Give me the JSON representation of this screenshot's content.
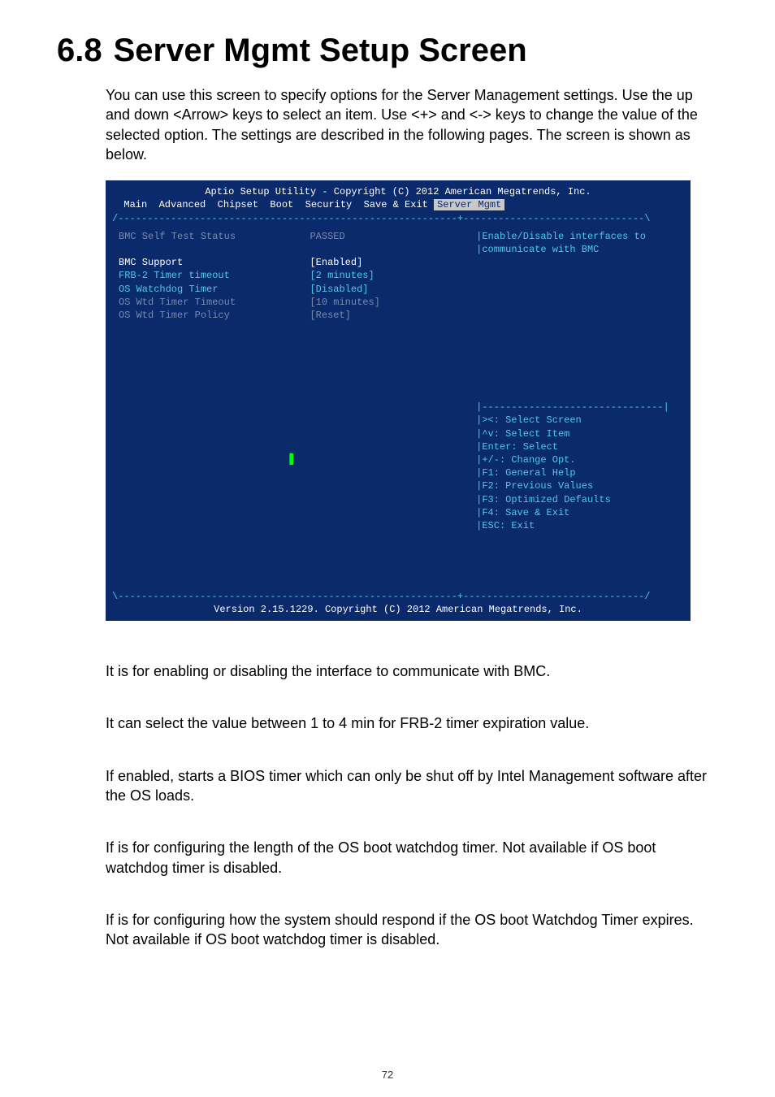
{
  "heading": {
    "num": "6.8",
    "title": "Server Mgmt Setup Screen"
  },
  "intro": "You can use this screen to specify options for the Server Management settings. Use the up and down <Arrow> keys to select an item. Use <+> and <-> keys to change the value of the selected option. The settings are described in the following pages. The screen is shown as below.",
  "bios": {
    "header": "Aptio Setup Utility - Copyright (C) 2012 American Megatrends, Inc.",
    "menu": {
      "left": "  Main  Advanced  Chipset  Boot  Security  Save & Exit ",
      "selected": "Server Mgmt"
    },
    "sep_top": "/----------------------------------------------------------+-------------------------------\\",
    "rows": [
      {
        "lbl": "BMC Self Test Status",
        "val": "PASSED",
        "cls": "grey"
      },
      {
        "lbl": "",
        "val": "",
        "cls": "grey"
      },
      {
        "lbl": "BMC Support",
        "val": "[Enabled]",
        "cls": "white"
      },
      {
        "lbl": "FRB-2 Timer timeout",
        "val": "[2 minutes]",
        "cls": "cyan"
      },
      {
        "lbl": "OS Watchdog Timer",
        "val": "[Disabled]",
        "cls": "cyan"
      },
      {
        "lbl": "OS Wtd Timer Timeout",
        "val": "[10 minutes]",
        "cls": "grey"
      },
      {
        "lbl": "OS Wtd Timer Policy",
        "val": "[Reset]",
        "cls": "grey"
      }
    ],
    "help_top": [
      "|Enable/Disable interfaces to",
      "|communicate with BMC"
    ],
    "help_sep": "|-------------------------------|",
    "help_keys": [
      "|><: Select Screen",
      "|^v: Select Item",
      "|Enter: Select",
      "|+/-: Change Opt.",
      "|F1: General Help",
      "|F2: Previous Values",
      "|F3: Optimized Defaults",
      "|F4: Save & Exit",
      "|ESC: Exit"
    ],
    "sep_bot": "\\----------------------------------------------------------+-------------------------------/",
    "footer": "Version 2.15.1229. Copyright (C) 2012 American Megatrends, Inc."
  },
  "paras": [
    "It is for enabling or disabling the interface to communicate with BMC.",
    "It can select the value between 1 to 4 min for FRB-2 timer expiration value.",
    "If enabled, starts a BIOS timer which can only be shut off by Intel Management software after the OS loads.",
    "If is for configuring the length of the OS boot watchdog timer. Not available if OS boot watchdog timer is disabled.",
    "If is for configuring how the system should respond if the OS boot Watchdog Timer expires. Not available if OS boot watchdog timer is disabled."
  ],
  "pagenum": "72"
}
